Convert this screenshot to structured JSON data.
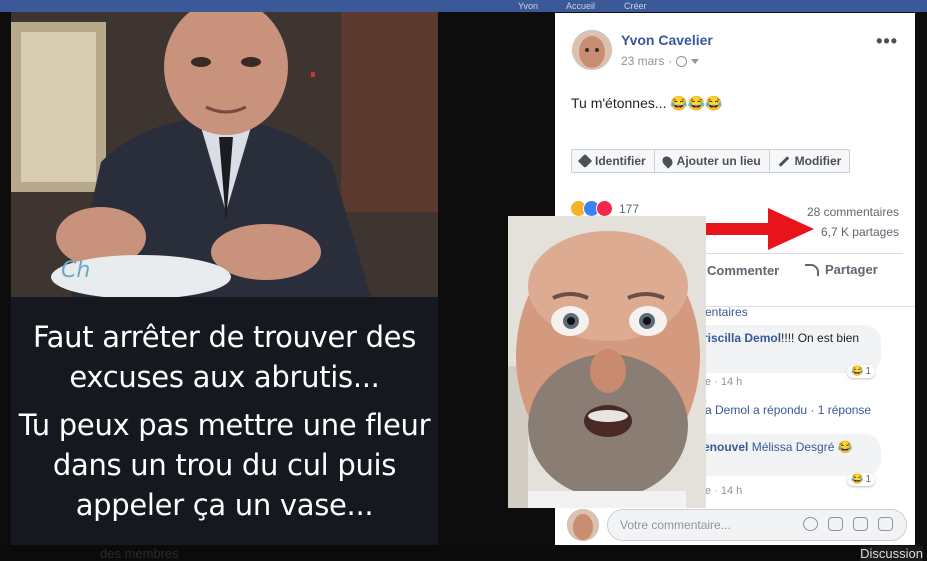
{
  "top_strip": {
    "name": "Yvon",
    "item2": "Accueil",
    "item3": "Créer"
  },
  "left_image": {
    "caption_line1": "Faut arrêter de trouver des excuses aux abrutis...",
    "caption_line2": "Tu peux pas mettre une fleur dans un trou du cul puis appeler ça un vase..."
  },
  "post": {
    "author": "Yvon Cavelier",
    "date": "23 mars",
    "more": "•••",
    "text": "Tu m'étonnes... 😂😂😂",
    "tag_buttons": {
      "identify": "Identifier",
      "location": "Ajouter un lieu",
      "edit": "Modifier"
    },
    "reaction_count": "177",
    "comments_count": "28 commentaires",
    "shares_count": "6,7 K partages",
    "actions": {
      "comment": "Commenter",
      "share": "Partager"
    },
    "comments_header": "entaires",
    "comment1": {
      "name": "riscilla Demol",
      "text": "!!!! On est bien",
      "emoji": "😂",
      "meta": "e · 14 h",
      "react_count": "1"
    },
    "replied_text": "a Demol a répondu · 1 réponse",
    "comment2": {
      "name": "enouvel",
      "mention": "Mélissa Desgré",
      "emoji": "😂",
      "meta": "e · 14 h",
      "react_count": "1"
    },
    "comment_placeholder": "Votre commentaire..."
  },
  "bottom_strip": {
    "left": "des membres",
    "right": "Discussion"
  },
  "colors": {
    "fb_blue": "#385898",
    "arrow_red": "#e8141c",
    "text_gray": "#616770"
  }
}
